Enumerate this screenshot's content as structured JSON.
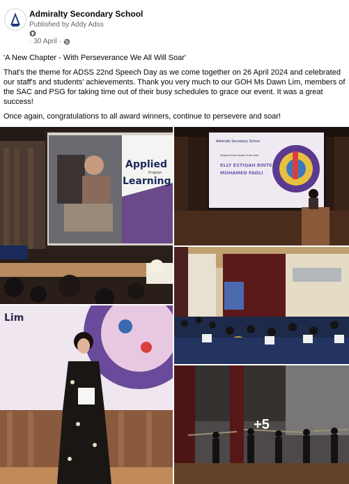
{
  "post": {
    "page_name": "Admiralty Secondary School",
    "published_by": "Published by Addy Adss",
    "date": "30 April",
    "separator": "·"
  },
  "text": {
    "quote": "'A New Chapter - With Perseverance We All Will Soar'",
    "paragraph1": "That's the theme for ADSS 22nd Speech Day as we come together on 26 April 2024 and celebrated our staff's and students' achievements. Thank you very much to our GOH Ms Dawn Lim, members of the SAC and PSG for taking time out of their busy schedules to grace our event. It was a great success!",
    "paragraph2": "Once again, congratulations to all award winners, continue to persevere and soar!"
  },
  "photos": {
    "slide1_title_line1": "Applied",
    "slide1_subtitle": "Program",
    "slide1_title_line2": "Learning",
    "slide2_school": "Admiralty Secondary School",
    "slide2_award": "Student Role Model of the Year",
    "slide2_name_line1": "ELLY ESTIQAH BINTE",
    "slide2_name_line2": "MOHAMED FADLI",
    "slide4_text": "Lim",
    "more_count": "+5"
  },
  "icons": {
    "avatar": "school-crest-icon",
    "location": "location-pin-icon",
    "audience": "globe-icon"
  }
}
